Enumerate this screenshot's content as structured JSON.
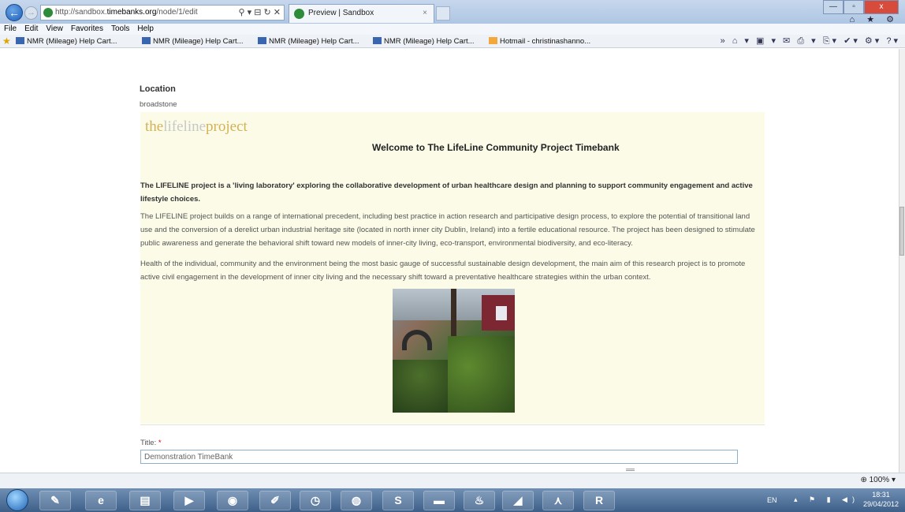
{
  "browser": {
    "address_prefix": "http://sandbox.",
    "address_domain": "timebanks.org",
    "address_path": "/node/1/edit",
    "address_controls": "⚲ ▾ ⊟ ↻ ✕",
    "tab_title": "Preview | Sandbox",
    "tab_close": "×",
    "window_controls": [
      "—",
      "▫",
      "x"
    ],
    "right_icons": "⌂ ★ ⚙"
  },
  "menu": [
    "File",
    "Edit",
    "View",
    "Favorites",
    "Tools",
    "Help"
  ],
  "favorites": [
    "NMR (Mileage) Help Cart...",
    "NMR (Mileage) Help Cart...",
    "NMR (Mileage) Help Cart...",
    "NMR (Mileage) Help Cart...",
    "Hotmail - christinashanno..."
  ],
  "command_bar": "» ⌂ ▾ ▣ ▾ ✉ ⎙ ▾ ⎘▾ ✔▾ ⚙▾ ?▾",
  "page": {
    "location_label": "Location",
    "location_value": "broadstone",
    "logo_pre": "the",
    "logo_mid": "lifeline",
    "logo_post": "project",
    "welcome": "Welcome to The LifeLine Community Project Timebank",
    "intro": "The LIFELINE project is a 'living laboratory' exploring the collaborative development of urban healthcare design and planning to support community engagement and active lifestyle choices.",
    "para1": "The LIFELINE project builds on a range of international precedent, including best practice in action research and participative design process, to explore the potential of transitional land use and the conversion of a derelict urban industrial heritage site (located in north inner city Dublin, Ireland) into a fertile educational resource. The project has been designed to stimulate public awareness and generate the behavioral shift toward new models of inner-city living, eco-transport, environmental biodiversity, and eco-literacy.",
    "para2": "Health of the individual, community and the environment being the most basic gauge of successful sustainable design development, the main aim of this research project is to promote active civil engagement in the development of inner city living and the necessary shift toward a preventative healthcare strategies within the urban context.",
    "title_label": "Title:",
    "title_required": "*",
    "title_value": "Demonstration TimeBank"
  },
  "status": {
    "zoom": "100%"
  },
  "taskbar": {
    "lang": "EN",
    "time": "18:31",
    "date": "29/04/2012",
    "tray_icons": "▴ ⚑ ▮ ◀)"
  }
}
